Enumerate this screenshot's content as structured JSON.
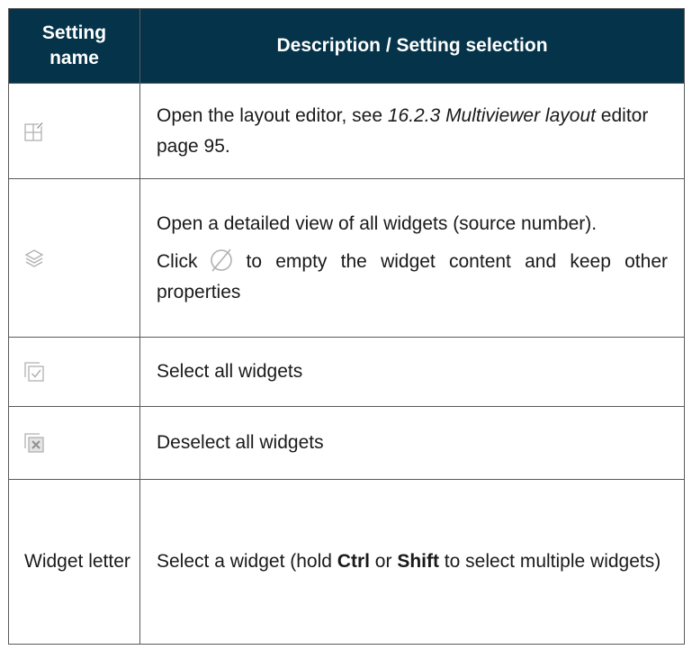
{
  "header": {
    "col1": "Setting\nname",
    "col1_line1": "Setting",
    "col1_line2": "name",
    "col2": "Description / Setting selection"
  },
  "rows": [
    {
      "icon": "layout-editor-icon",
      "desc_pre": "Open the layout editor, see ",
      "desc_italic": "16.2.3 Multiviewer layout",
      "desc_post": " editor page 95."
    },
    {
      "icon": "layers-icon",
      "desc_line1": "Open a detailed view of all widgets (source number).",
      "click_pre": "Click",
      "click_icon": "empty-set-icon",
      "click_post": "to empty the widget content and keep other properties"
    },
    {
      "icon": "select-all-icon",
      "desc": "Select all widgets"
    },
    {
      "icon": "deselect-all-icon",
      "desc": "Deselect all widgets"
    },
    {
      "name": "Widget letter",
      "desc_pre": "Select a widget (hold ",
      "key1": "Ctrl",
      "desc_mid": " or ",
      "key2": "Shift",
      "desc_post": " to select multiple widgets)"
    }
  ],
  "colors": {
    "header_bg": "#053349",
    "header_text": "#ffffff",
    "border": "#5a5a5a",
    "icon_gray": "#b0b0b0"
  }
}
